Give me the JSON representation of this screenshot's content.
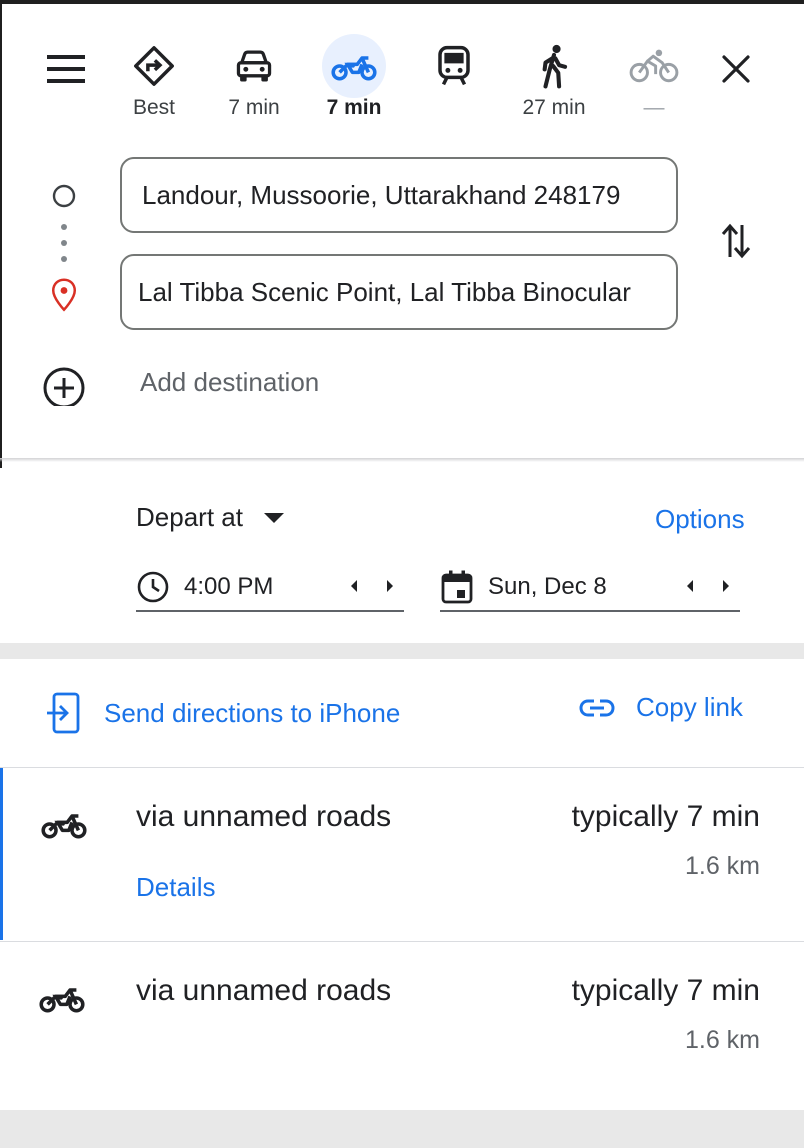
{
  "modes": [
    {
      "icon": "directions-best-icon",
      "label": "Best"
    },
    {
      "icon": "car-icon",
      "label": "7 min"
    },
    {
      "icon": "motorcycle-icon",
      "label": "7 min"
    },
    {
      "icon": "transit-icon",
      "label": ""
    },
    {
      "icon": "walking-icon",
      "label": "27 min"
    },
    {
      "icon": "bicycle-icon",
      "label": "—"
    }
  ],
  "active_mode": "motorcycle",
  "origin": {
    "value": "Landour, Mussoorie, Uttarakhand 248179"
  },
  "destination": {
    "value": "Lal Tibba Scenic Point, Lal Tibba Binocular"
  },
  "add_destination": "Add destination",
  "depart": {
    "label": "Depart at",
    "options": "Options",
    "time": "4:00 PM",
    "date": "Sun, Dec 8"
  },
  "share": {
    "send": "Send directions to iPhone",
    "copy": "Copy link"
  },
  "routes": [
    {
      "via": "via unnamed roads",
      "time": "typically 7 min",
      "distance": "1.6 km",
      "details": "Details"
    },
    {
      "via": "via unnamed roads",
      "time": "typically 7 min",
      "distance": "1.6 km"
    }
  ],
  "colors": {
    "accent": "#1a73e8",
    "active_mode_bg": "#e8f0fe",
    "destination_pin": "#d93025",
    "text": "#202124",
    "secondary_text": "#5f6368"
  }
}
